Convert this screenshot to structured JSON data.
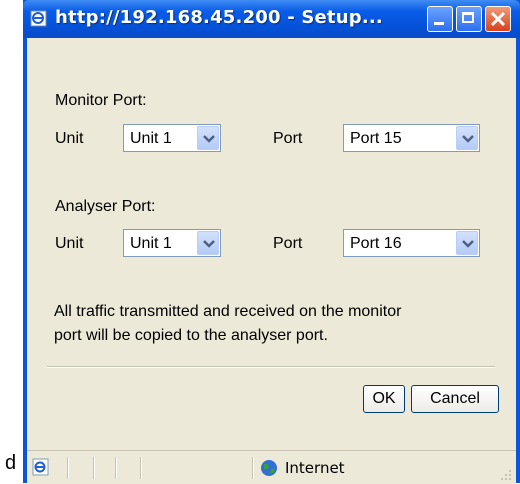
{
  "stray_text": "d",
  "window": {
    "title": "http://192.168.45.200 - Setup..."
  },
  "monitor": {
    "heading": "Monitor Port:",
    "unit_label": "Unit",
    "unit_value": "Unit 1",
    "port_label": "Port",
    "port_value": "Port 15"
  },
  "analyser": {
    "heading": "Analyser Port:",
    "unit_label": "Unit",
    "unit_value": "Unit 1",
    "port_label": "Port",
    "port_value": "Port 16"
  },
  "description": {
    "line1": "All traffic transmitted and received on the monitor",
    "line2": "port will be copied to the analyser port."
  },
  "buttons": {
    "ok": "OK",
    "cancel": "Cancel"
  },
  "statusbar": {
    "zone": "Internet"
  },
  "colors": {
    "titlebar": "#0552d9",
    "face": "#ece9d8",
    "close": "#d8421d"
  }
}
